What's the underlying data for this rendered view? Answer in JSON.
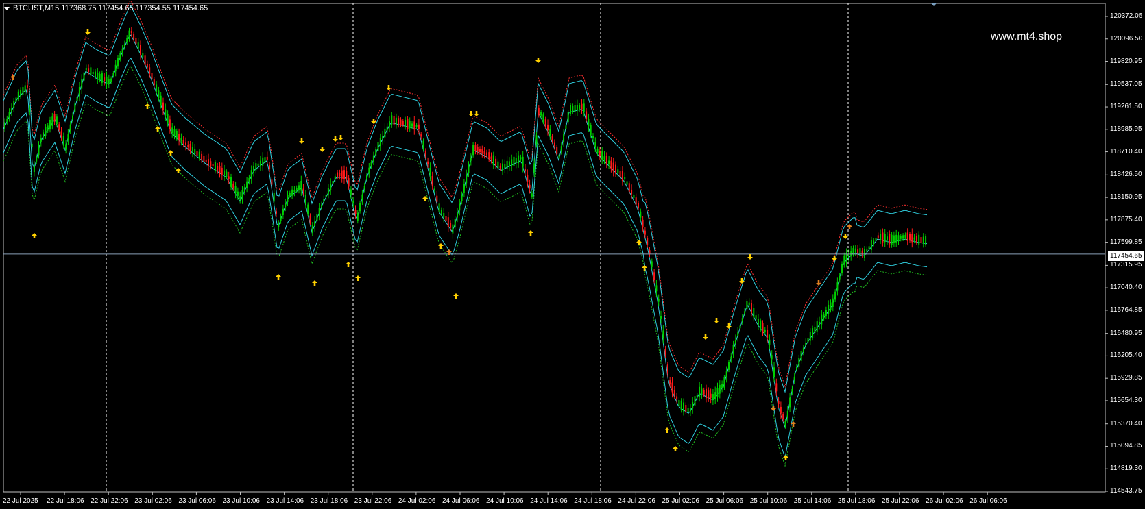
{
  "window": {
    "symbol_header": "BTCUST,M15  117368.75 117454.65 117354.55 117454.65",
    "watermark": "www.mt4.shop",
    "current_price": "117454.65"
  },
  "price_axis": [
    {
      "label": "120372.05",
      "value": 120372.05
    },
    {
      "label": "120096.50",
      "value": 120096.5
    },
    {
      "label": "119820.95",
      "value": 119820.95
    },
    {
      "label": "119537.05",
      "value": 119537.05
    },
    {
      "label": "119261.50",
      "value": 119261.5
    },
    {
      "label": "118985.95",
      "value": 118985.95
    },
    {
      "label": "118710.40",
      "value": 118710.4
    },
    {
      "label": "118426.50",
      "value": 118426.5
    },
    {
      "label": "118150.95",
      "value": 118150.95
    },
    {
      "label": "117875.40",
      "value": 117875.4
    },
    {
      "label": "117599.85",
      "value": 117599.85
    },
    {
      "label": "117315.95",
      "value": 117315.95
    },
    {
      "label": "117040.40",
      "value": 117040.4
    },
    {
      "label": "116764.85",
      "value": 116764.85
    },
    {
      "label": "116480.95",
      "value": 116480.95
    },
    {
      "label": "116205.40",
      "value": 116205.4
    },
    {
      "label": "115929.85",
      "value": 115929.85
    },
    {
      "label": "115654.30",
      "value": 115654.3
    },
    {
      "label": "115370.40",
      "value": 115370.4
    },
    {
      "label": "115094.85",
      "value": 115094.85
    },
    {
      "label": "114819.30",
      "value": 114819.3
    },
    {
      "label": "114543.75",
      "value": 114543.75
    }
  ],
  "time_axis": [
    "22 Jul 2025",
    "22 Jul 18:06",
    "22 Jul 22:06",
    "23 Jul 02:06",
    "23 Jul 06:06",
    "23 Jul 10:06",
    "23 Jul 14:06",
    "23 Jul 18:06",
    "23 Jul 22:06",
    "24 Jul 02:06",
    "24 Jul 06:06",
    "24 Jul 10:06",
    "24 Jul 14:06",
    "24 Jul 18:06",
    "24 Jul 22:06",
    "25 Jul 02:06",
    "25 Jul 06:06",
    "25 Jul 10:06",
    "25 Jul 14:06",
    "25 Jul 18:06",
    "25 Jul 22:06",
    "26 Jul 02:06",
    "26 Jul 06:06"
  ],
  "colors": {
    "background": "#000000",
    "bull_candle": "#00d000",
    "bear_candle": "#ff1a1a",
    "band": "#30d0e0",
    "upper_dotted": "#ff3030",
    "lower_dotted": "#20c020",
    "arrow": "#ffd000",
    "small_arrow": "#e08020",
    "grid_separator": "#ffffff"
  },
  "icons": {
    "up_signal": "up-arrow-icon",
    "down_signal": "down-arrow-icon",
    "dropdown": "triangle-down-icon"
  }
}
